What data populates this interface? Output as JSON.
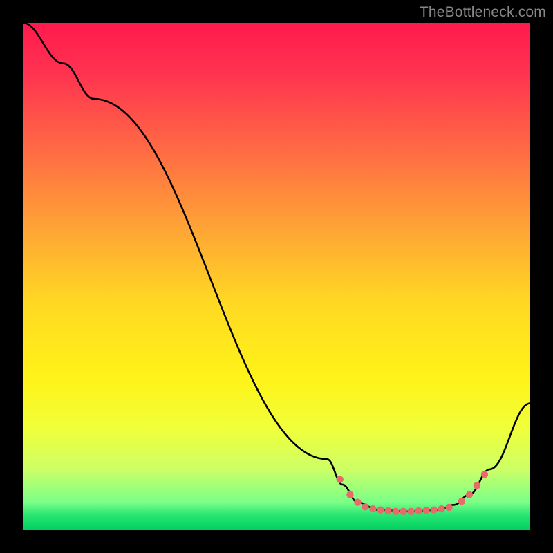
{
  "watermark": "TheBottleneck.com",
  "gradient": {
    "stops": [
      {
        "offset": 0.0,
        "color": "#ff1a4d"
      },
      {
        "offset": 0.1,
        "color": "#ff3350"
      },
      {
        "offset": 0.25,
        "color": "#ff6a44"
      },
      {
        "offset": 0.4,
        "color": "#ffa236"
      },
      {
        "offset": 0.55,
        "color": "#ffd823"
      },
      {
        "offset": 0.7,
        "color": "#fff318"
      },
      {
        "offset": 0.8,
        "color": "#f0ff3a"
      },
      {
        "offset": 0.88,
        "color": "#ccff66"
      },
      {
        "offset": 0.945,
        "color": "#7aff88"
      },
      {
        "offset": 0.97,
        "color": "#28e673"
      },
      {
        "offset": 1.0,
        "color": "#00d060"
      }
    ]
  },
  "curve_color": "#000000",
  "marker_color": "#e86a6a",
  "chart_data": {
    "type": "line",
    "title": "",
    "xlabel": "",
    "ylabel": "",
    "xlim": [
      0,
      100
    ],
    "ylim": [
      0,
      100
    ],
    "series": [
      {
        "name": "curve",
        "points": [
          {
            "x": 0,
            "y": 100
          },
          {
            "x": 8,
            "y": 92
          },
          {
            "x": 14,
            "y": 85
          },
          {
            "x": 60,
            "y": 14
          },
          {
            "x": 63,
            "y": 9
          },
          {
            "x": 66,
            "y": 5.5
          },
          {
            "x": 70,
            "y": 4.0
          },
          {
            "x": 76,
            "y": 3.7
          },
          {
            "x": 82,
            "y": 4.0
          },
          {
            "x": 85,
            "y": 5.0
          },
          {
            "x": 88,
            "y": 7.0
          },
          {
            "x": 92,
            "y": 12
          },
          {
            "x": 100,
            "y": 25
          }
        ]
      }
    ],
    "markers": [
      {
        "x": 62.5,
        "y": 10.0
      },
      {
        "x": 64.5,
        "y": 7.0
      },
      {
        "x": 66.0,
        "y": 5.5
      },
      {
        "x": 67.5,
        "y": 4.6
      },
      {
        "x": 69.0,
        "y": 4.2
      },
      {
        "x": 70.5,
        "y": 4.0
      },
      {
        "x": 72.0,
        "y": 3.8
      },
      {
        "x": 73.5,
        "y": 3.7
      },
      {
        "x": 75.0,
        "y": 3.7
      },
      {
        "x": 76.5,
        "y": 3.7
      },
      {
        "x": 78.0,
        "y": 3.8
      },
      {
        "x": 79.5,
        "y": 3.9
      },
      {
        "x": 81.0,
        "y": 4.0
      },
      {
        "x": 82.5,
        "y": 4.2
      },
      {
        "x": 84.0,
        "y": 4.5
      },
      {
        "x": 86.5,
        "y": 5.7
      },
      {
        "x": 88.0,
        "y": 7.0
      },
      {
        "x": 89.5,
        "y": 8.8
      },
      {
        "x": 91.0,
        "y": 11.0
      }
    ]
  }
}
